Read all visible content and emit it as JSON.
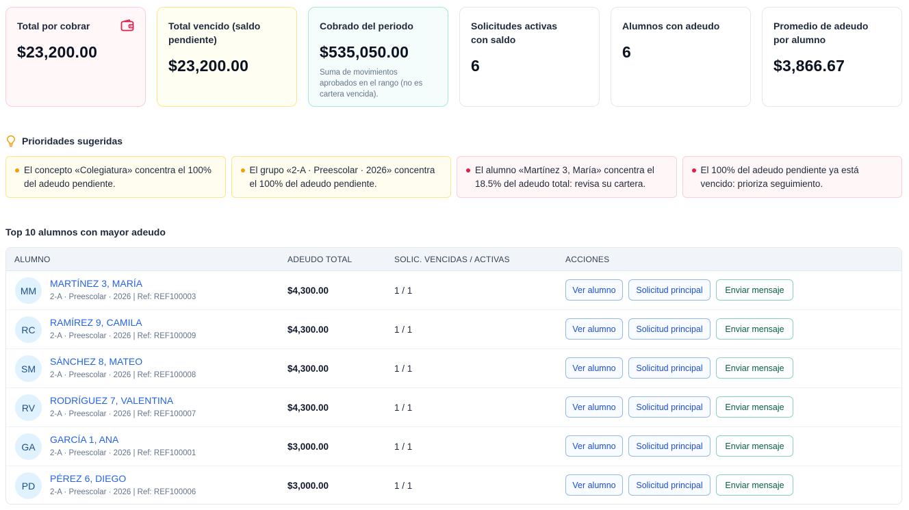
{
  "kpis": [
    {
      "label": "Total por cobrar",
      "value": "$23,200.00",
      "note": ""
    },
    {
      "label": "Total vencido (saldo pendiente)",
      "value": "$23,200.00",
      "note": ""
    },
    {
      "label": "Cobrado del periodo",
      "value": "$535,050.00",
      "note": "Suma de movimientos aprobados en el rango (no es cartera vencida)."
    },
    {
      "label": "Solicitudes activas con saldo",
      "value": "6",
      "note": ""
    },
    {
      "label": "Alumnos con adeudo",
      "value": "6",
      "note": ""
    },
    {
      "label": "Promedio de adeudo por alumno",
      "value": "$3,866.67",
      "note": ""
    }
  ],
  "priorities": {
    "title": "Prioridades sugeridas",
    "items": [
      {
        "text": "El concepto «Colegiatura» concentra el 100% del adeudo pendiente.",
        "level": "warning"
      },
      {
        "text": "El grupo «2-A · Preescolar · 2026» concentra el 100% del adeudo pendiente.",
        "level": "warning"
      },
      {
        "text": "El alumno «Martínez 3, María» concentra el 18.5% del adeudo total: revisa su cartera.",
        "level": "danger"
      },
      {
        "text": "El 100% del adeudo pendiente ya está vencido: prioriza seguimiento.",
        "level": "danger"
      }
    ]
  },
  "top": {
    "title": "Top 10 alumnos con mayor adeudo",
    "columns": {
      "student": "ALUMNO",
      "debt": "ADEUDO TOTAL",
      "requests": "SOLIC. VENCIDAS / ACTIVAS",
      "actions": "ACCIONES"
    },
    "actions": {
      "view": "Ver alumno",
      "main_request": "Solicitud principal",
      "message": "Enviar mensaje"
    },
    "rows": [
      {
        "initials": "MM",
        "name": "MARTÍNEZ 3, MARÍA",
        "sub": "2-A · Preescolar · 2026 | Ref: REF100003",
        "debt": "$4,300.00",
        "ratio": "1 / 1"
      },
      {
        "initials": "RC",
        "name": "RAMÍREZ 9, CAMILA",
        "sub": "2-A · Preescolar · 2026 | Ref: REF100009",
        "debt": "$4,300.00",
        "ratio": "1 / 1"
      },
      {
        "initials": "SM",
        "name": "SÁNCHEZ 8, MATEO",
        "sub": "2-A · Preescolar · 2026 | Ref: REF100008",
        "debt": "$4,300.00",
        "ratio": "1 / 1"
      },
      {
        "initials": "RV",
        "name": "RODRÍGUEZ 7, VALENTINA",
        "sub": "2-A · Preescolar · 2026 | Ref: REF100007",
        "debt": "$4,300.00",
        "ratio": "1 / 1"
      },
      {
        "initials": "GA",
        "name": "GARCÍA 1, ANA",
        "sub": "2-A · Preescolar · 2026 | Ref: REF100001",
        "debt": "$3,000.00",
        "ratio": "1 / 1"
      },
      {
        "initials": "PD",
        "name": "PÉREZ 6, DIEGO",
        "sub": "2-A · Preescolar · 2026 | Ref: REF100006",
        "debt": "$3,000.00",
        "ratio": "1 / 1"
      }
    ]
  },
  "colors": {
    "accent": "#2563eb",
    "warning": "#f59e0b",
    "danger": "#e11d48",
    "wallet": "#e11d48"
  },
  "icons": {
    "kpi_receivable": "wallet-icon",
    "priorities": "lightbulb-icon"
  }
}
